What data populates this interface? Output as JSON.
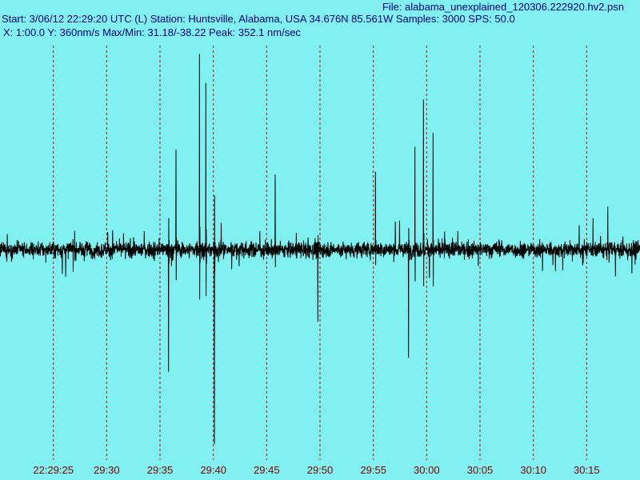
{
  "header": {
    "file_line": "File: alabama_unexplained_120306.222920.hv2.psn",
    "start_line": "Start: 3/06/12 22:29:20 UTC (L) Station: Huntsville, Alabama, USA 34.676N 85.561W Samples: 3000  SPS: 50.0",
    "info_line": "X: 1:00.0 Y: 360nm/s Max/Min: 31.18/-38.22  Peak: 352.1 nm/sec"
  },
  "colors": {
    "background": "#80F0F0",
    "header_text": "#000080",
    "trace": "#000000",
    "gridline": "#D00000",
    "tick_label": "#800000"
  },
  "chart_data": {
    "type": "line",
    "title": "",
    "xlabel": "",
    "ylabel": "",
    "x_start": "22:29:20",
    "x_end": "22:30:20",
    "ylim": [
      -360,
      360
    ],
    "grid": "vertical dashed",
    "tick_labels": [
      "22:29:25",
      "29:30",
      "29:35",
      "29:40",
      "29:45",
      "29:50",
      "29:55",
      "30:00",
      "30:05",
      "30:10",
      "30:15"
    ],
    "tick_seconds": [
      5,
      10,
      15,
      20,
      25,
      30,
      35,
      40,
      45,
      50,
      55
    ],
    "samples": 3000,
    "sps": 50.0,
    "max": 31.18,
    "min": -38.22,
    "peak": 352.1,
    "spikes": [
      {
        "t": 18.7,
        "v": 352.1
      },
      {
        "t": 20.1,
        "v": -350.0
      },
      {
        "t": 19.3,
        "v": 300.0
      },
      {
        "t": 15.8,
        "v": -220.0
      },
      {
        "t": 16.5,
        "v": 180.0
      },
      {
        "t": 39.7,
        "v": 270.0
      },
      {
        "t": 38.3,
        "v": -195.0
      },
      {
        "t": 38.9,
        "v": 185.0
      },
      {
        "t": 40.6,
        "v": 210.0
      },
      {
        "t": 29.8,
        "v": -130.0
      },
      {
        "t": 25.8,
        "v": 135.0
      },
      {
        "t": 35.2,
        "v": 140.0
      }
    ]
  }
}
